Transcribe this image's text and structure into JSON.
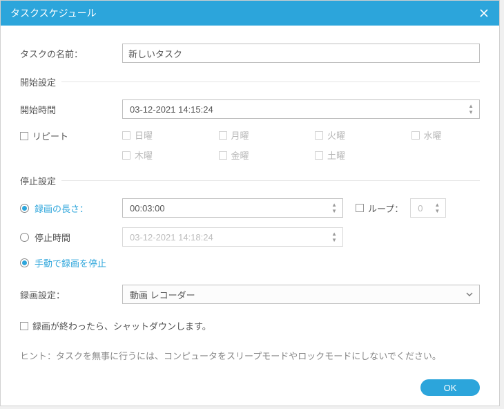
{
  "title": "タスクスケジュール",
  "task_name_label": "タスクの名前：",
  "task_name_value": "新しいタスク",
  "sections": {
    "start": "開始設定",
    "stop": "停止設定"
  },
  "start": {
    "time_label": "開始時間",
    "time_value": "03-12-2021 14:15:24",
    "repeat_label": "リピート",
    "days": {
      "sun": "日曜",
      "mon": "月曜",
      "tue": "火曜",
      "wed": "水曜",
      "thu": "木曜",
      "fri": "金曜",
      "sat": "土曜"
    }
  },
  "stop": {
    "length_label": "録画の長さ：",
    "length_value": "00:03:00",
    "loop_label": "ループ：",
    "loop_value": "0",
    "stop_time_label": "停止時間",
    "stop_time_value": "03-12-2021 14:18:24",
    "manual_label": "手動で録画を停止"
  },
  "record_settings": {
    "label": "録画設定：",
    "value": "動画 レコーダー"
  },
  "shutdown_label": "録画が終わったら、シャットダウンします。",
  "hint": "ヒント：タスクを無事に行うには、コンピュータをスリープモードやロックモードにしないでください。",
  "ok_label": "OK"
}
